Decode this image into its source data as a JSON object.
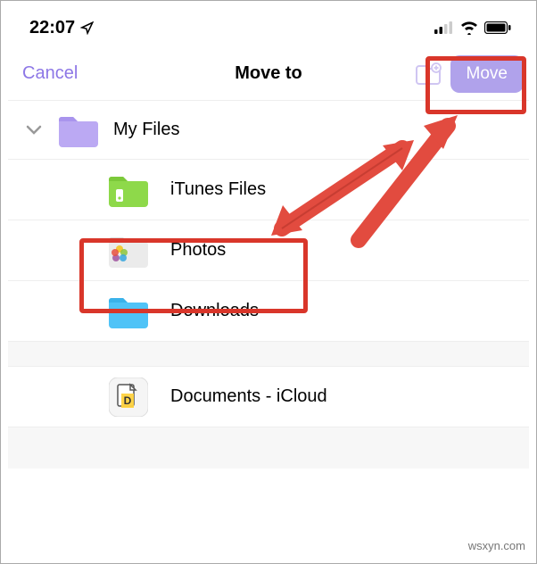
{
  "status": {
    "time": "22:07"
  },
  "nav": {
    "cancel": "Cancel",
    "title": "Move to",
    "move": "Move"
  },
  "root": {
    "label": "My Files"
  },
  "items": [
    {
      "label": "iTunes Files"
    },
    {
      "label": "Photos"
    },
    {
      "label": "Downloads"
    }
  ],
  "cloud": {
    "label": "Documents - iCloud"
  },
  "watermark": "wsxyn.com"
}
